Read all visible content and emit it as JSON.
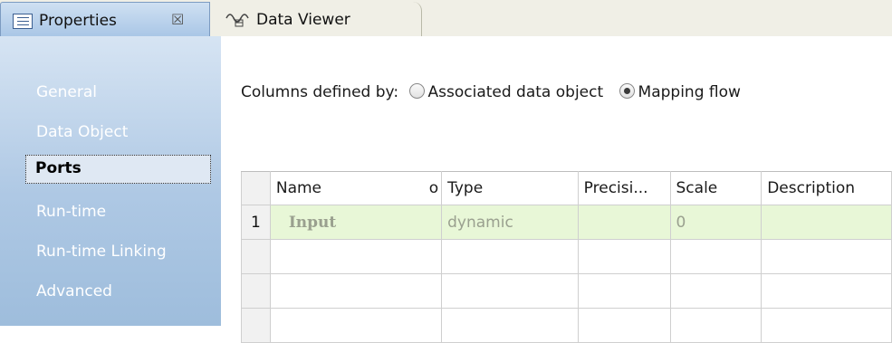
{
  "tabs": {
    "properties_label": "Properties",
    "close_glyph": "☒",
    "data_viewer_label": "Data Viewer"
  },
  "sidebar": {
    "items": [
      {
        "label": "General"
      },
      {
        "label": "Data Object"
      },
      {
        "label": "Ports"
      },
      {
        "label": "Run-time"
      },
      {
        "label": "Run-time Linking"
      },
      {
        "label": "Advanced"
      }
    ],
    "selected": "Ports"
  },
  "columns_defined": {
    "label": "Columns defined by:",
    "option1": "Associated data object",
    "option2": "Mapping flow",
    "selected": "Mapping flow"
  },
  "table": {
    "headers": [
      "Name",
      "o",
      "Type",
      "Precisi...",
      "Scale",
      "Description"
    ],
    "rows": [
      {
        "num": "1",
        "name": "Input",
        "type": "dynamic",
        "precision": "",
        "scale": "0",
        "description": ""
      }
    ]
  },
  "colors": {
    "active_tab": "#b9d1ec",
    "sidebar": "#aec8e4",
    "selected_row": "#e8f7d7"
  }
}
